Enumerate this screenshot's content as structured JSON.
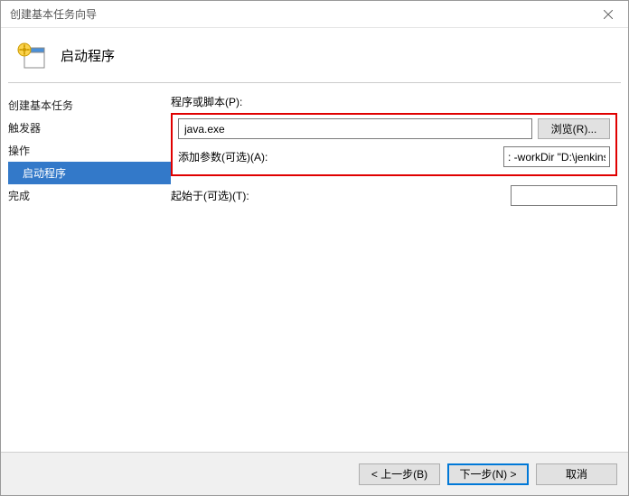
{
  "window": {
    "title": "创建基本任务向导"
  },
  "header": {
    "title": "启动程序"
  },
  "sidebar": {
    "items": [
      {
        "label": "创建基本任务",
        "active": false,
        "sub": false
      },
      {
        "label": "触发器",
        "active": false,
        "sub": false
      },
      {
        "label": "操作",
        "active": false,
        "sub": false
      },
      {
        "label": "启动程序",
        "active": true,
        "sub": true
      },
      {
        "label": "完成",
        "active": false,
        "sub": false
      }
    ]
  },
  "form": {
    "program_label": "程序或脚本(P):",
    "program_value": "java.exe",
    "browse_label": "浏览(R)...",
    "args_label": "添加参数(可选)(A):",
    "args_value": ": -workDir \"D:\\jenkins\"",
    "startin_label": "起始于(可选)(T):",
    "startin_value": ""
  },
  "footer": {
    "back": "< 上一步(B)",
    "next": "下一步(N) >",
    "cancel": "取消"
  }
}
